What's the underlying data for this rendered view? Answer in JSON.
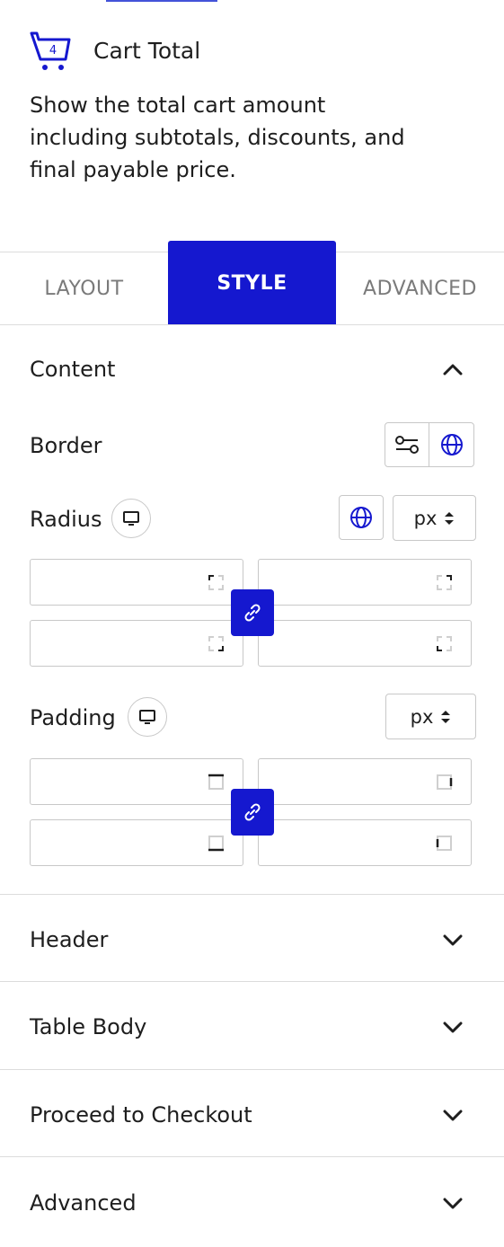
{
  "widget": {
    "title": "Cart Total",
    "description": "Show the total cart amount including subtotals, discounts, and final payable price.",
    "icon": "cart-icon",
    "badge": "4"
  },
  "tabs": [
    {
      "label": "LAYOUT",
      "active": false
    },
    {
      "label": "STYLE",
      "active": true
    },
    {
      "label": "ADVANCED",
      "active": false
    }
  ],
  "content_section": {
    "title": "Content",
    "expanded": true,
    "border": {
      "label": "Border"
    },
    "radius": {
      "label": "Radius",
      "unit": "px",
      "values": [
        "",
        "",
        "",
        ""
      ]
    },
    "padding": {
      "label": "Padding",
      "unit": "px",
      "values": [
        "",
        "",
        "",
        ""
      ]
    }
  },
  "sections": [
    {
      "title": "Header",
      "expanded": false
    },
    {
      "title": "Table Body",
      "expanded": false
    },
    {
      "title": "Proceed to Checkout",
      "expanded": false
    },
    {
      "title": "Advanced",
      "expanded": false
    }
  ],
  "colors": {
    "accent": "#1518cf",
    "border": "#c8c8c8",
    "divider": "#dcdcdc",
    "text": "#1e1e1e",
    "muted_tab": "#7a7a7a"
  }
}
